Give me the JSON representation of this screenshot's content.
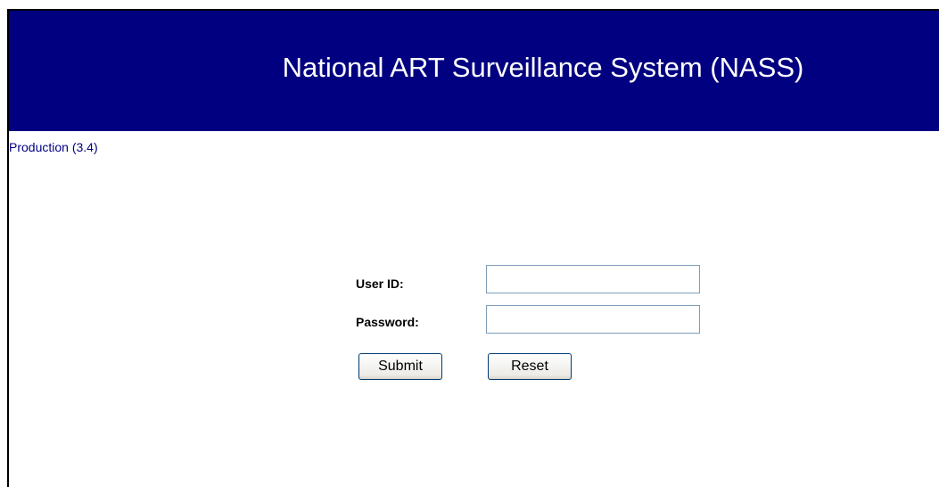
{
  "header": {
    "title": "National ART Surveillance System (NASS)"
  },
  "environment": {
    "label": "Production (3.4)"
  },
  "login_form": {
    "user_id_label": "User ID:",
    "user_id_value": "",
    "password_label": "Password:",
    "password_value": "",
    "submit_label": "Submit",
    "reset_label": "Reset"
  },
  "colors": {
    "banner_background": "#000080",
    "banner_text": "#ffffff",
    "environment_text": "#000080"
  }
}
